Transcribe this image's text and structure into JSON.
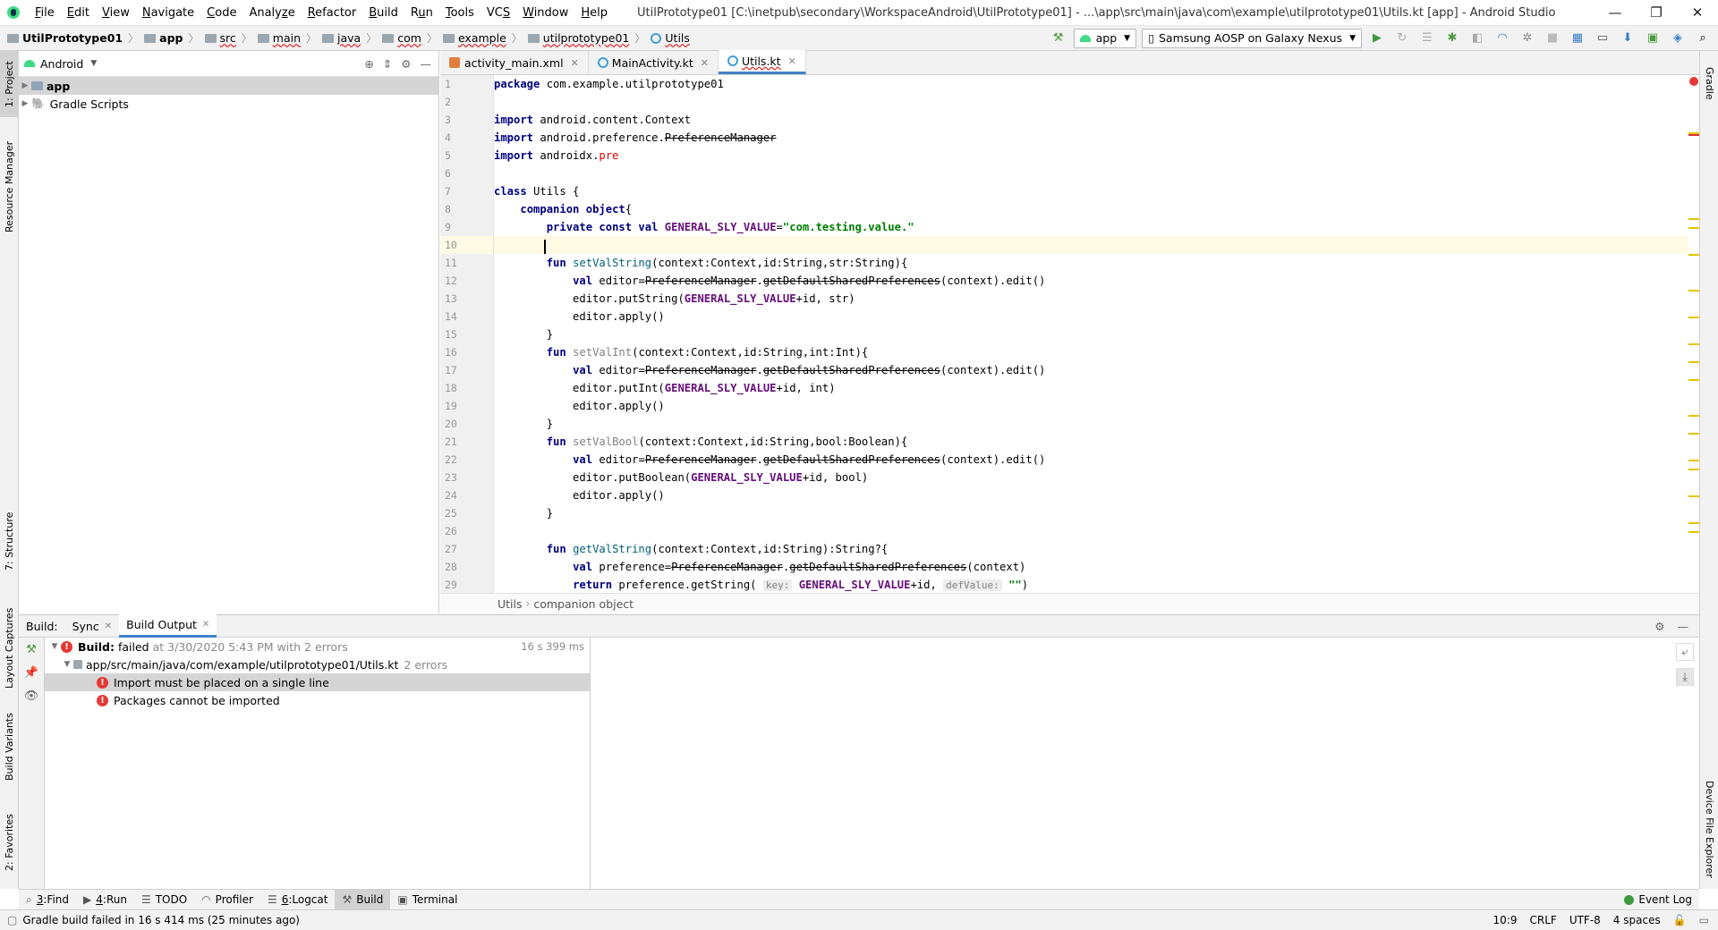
{
  "menu": {
    "items": [
      "File",
      "Edit",
      "View",
      "Navigate",
      "Code",
      "Analyze",
      "Refactor",
      "Build",
      "Run",
      "Tools",
      "VCS",
      "Window",
      "Help"
    ],
    "mnemonics": [
      "F",
      "E",
      "V",
      "N",
      "C",
      "z",
      "R",
      "B",
      "u",
      "T",
      "S",
      "W",
      "H"
    ],
    "window_title": "UtilPrototype01 [C:\\inetpub\\secondary\\WorkspaceAndroid\\UtilPrototype01] - ...\\app\\src\\main\\java\\com\\example\\utilprototype01\\Utils.kt [app] - Android Studio"
  },
  "window_controls": {
    "minimize": "—",
    "restore": "❐",
    "close": "✕"
  },
  "breadcrumb": [
    "UtilPrototype01",
    "app",
    "src",
    "main",
    "java",
    "com",
    "example",
    "utilprototype01",
    "Utils"
  ],
  "toolbar": {
    "run_config": "app",
    "device": "Samsung AOSP on Galaxy Nexus"
  },
  "left_strip": {
    "tabs": [
      "1: Project",
      "Resource Manager",
      "7: Structure",
      "Layout Captures",
      "Build Variants",
      "2: Favorites"
    ]
  },
  "right_strip": {
    "tabs": [
      "Gradle",
      "Device File Explorer"
    ]
  },
  "project_panel": {
    "view_mode": "Android",
    "tree": [
      {
        "label": "app",
        "selected": true
      },
      {
        "label": "Gradle Scripts",
        "selected": false
      }
    ]
  },
  "editor": {
    "tabs": [
      {
        "label": "activity_main.xml",
        "type": "xml",
        "active": false
      },
      {
        "label": "MainActivity.kt",
        "type": "kt",
        "active": false
      },
      {
        "label": "Utils.kt",
        "type": "kt",
        "active": true
      }
    ],
    "line_numbers": [
      "1",
      "2",
      "3",
      "4",
      "5",
      "6",
      "7",
      "8",
      "9",
      "10",
      "11",
      "12",
      "13",
      "14",
      "15",
      "16",
      "17",
      "18",
      "19",
      "20",
      "21",
      "22",
      "23",
      "24",
      "25",
      "26",
      "27",
      "28",
      "29"
    ],
    "current_line": 10,
    "code_lines": [
      [
        {
          "t": "package",
          "c": "kw"
        },
        {
          "t": " com.example.utilprototype01"
        }
      ],
      [],
      [
        {
          "t": "import",
          "c": "kw"
        },
        {
          "t": " android.content.Context"
        }
      ],
      [
        {
          "t": "import",
          "c": "kw"
        },
        {
          "t": " android.preference."
        },
        {
          "t": "PreferenceManager",
          "c": "dep"
        }
      ],
      [
        {
          "t": "import",
          "c": "kw"
        },
        {
          "t": " androidx."
        },
        {
          "t": "pre",
          "c": "unres"
        }
      ],
      [],
      [
        {
          "t": "class",
          "c": "kw"
        },
        {
          "t": " Utils {"
        }
      ],
      [
        {
          "t": "    "
        },
        {
          "t": "companion object",
          "c": "kw"
        },
        {
          "t": "{"
        }
      ],
      [
        {
          "t": "        "
        },
        {
          "t": "private const val",
          "c": "kw"
        },
        {
          "t": " "
        },
        {
          "t": "GENERAL_SLY_VALUE",
          "c": "cn"
        },
        {
          "t": "="
        },
        {
          "t": "\"com.testing.value.\"",
          "c": "str"
        }
      ],
      [
        {
          "t": "        "
        }
      ],
      [
        {
          "t": "        "
        },
        {
          "t": "fun",
          "c": "kw"
        },
        {
          "t": " "
        },
        {
          "t": "setValString",
          "c": "fnd"
        },
        {
          "t": "(context:Context,id:String,str:String){"
        }
      ],
      [
        {
          "t": "            "
        },
        {
          "t": "val",
          "c": "kw"
        },
        {
          "t": " editor="
        },
        {
          "t": "PreferenceManager",
          "c": "dep"
        },
        {
          "t": "."
        },
        {
          "t": "getDefaultSharedPreferences",
          "c": "dep"
        },
        {
          "t": "(context).edit()"
        }
      ],
      [
        {
          "t": "            editor.putString("
        },
        {
          "t": "GENERAL_SLY_VALUE",
          "c": "cn"
        },
        {
          "t": "+id, str)"
        }
      ],
      [
        {
          "t": "            editor.apply()"
        }
      ],
      [
        {
          "t": "        }"
        }
      ],
      [
        {
          "t": "        "
        },
        {
          "t": "fun",
          "c": "kw"
        },
        {
          "t": " "
        },
        {
          "t": "setValInt",
          "c": "gray"
        },
        {
          "t": "(context:Context,id:String,int:Int){"
        }
      ],
      [
        {
          "t": "            "
        },
        {
          "t": "val",
          "c": "kw"
        },
        {
          "t": " editor="
        },
        {
          "t": "PreferenceManager",
          "c": "dep"
        },
        {
          "t": "."
        },
        {
          "t": "getDefaultSharedPreferences",
          "c": "dep"
        },
        {
          "t": "(context).edit()"
        }
      ],
      [
        {
          "t": "            editor.putInt("
        },
        {
          "t": "GENERAL_SLY_VALUE",
          "c": "cn"
        },
        {
          "t": "+id, int)"
        }
      ],
      [
        {
          "t": "            editor.apply()"
        }
      ],
      [
        {
          "t": "        }"
        }
      ],
      [
        {
          "t": "        "
        },
        {
          "t": "fun",
          "c": "kw"
        },
        {
          "t": " "
        },
        {
          "t": "setValBool",
          "c": "gray"
        },
        {
          "t": "(context:Context,id:String,bool:Boolean){"
        }
      ],
      [
        {
          "t": "            "
        },
        {
          "t": "val",
          "c": "kw"
        },
        {
          "t": " editor="
        },
        {
          "t": "PreferenceManager",
          "c": "dep"
        },
        {
          "t": "."
        },
        {
          "t": "getDefaultSharedPreferences",
          "c": "dep"
        },
        {
          "t": "(context).edit()"
        }
      ],
      [
        {
          "t": "            editor.putBoolean("
        },
        {
          "t": "GENERAL_SLY_VALUE",
          "c": "cn"
        },
        {
          "t": "+id, bool)"
        }
      ],
      [
        {
          "t": "            editor.apply()"
        }
      ],
      [
        {
          "t": "        }"
        }
      ],
      [],
      [
        {
          "t": "        "
        },
        {
          "t": "fun",
          "c": "kw"
        },
        {
          "t": " "
        },
        {
          "t": "getValString",
          "c": "fnd"
        },
        {
          "t": "(context:Context,id:String):String?{"
        }
      ],
      [
        {
          "t": "            "
        },
        {
          "t": "val",
          "c": "kw"
        },
        {
          "t": " preference="
        },
        {
          "t": "PreferenceManager",
          "c": "dep"
        },
        {
          "t": "."
        },
        {
          "t": "getDefaultSharedPreferences",
          "c": "dep"
        },
        {
          "t": "(context)"
        }
      ],
      [
        {
          "t": "            "
        },
        {
          "t": "return",
          "c": "kw"
        },
        {
          "t": " preference.getString( "
        },
        {
          "t": "key:",
          "c": "hint"
        },
        {
          "t": " "
        },
        {
          "t": "GENERAL_SLY_VALUE",
          "c": "cn"
        },
        {
          "t": "+id, "
        },
        {
          "t": "defValue:",
          "c": "hint"
        },
        {
          "t": " "
        },
        {
          "t": "\"\"",
          "c": "str"
        },
        {
          "t": ")"
        }
      ]
    ],
    "breadcrumb": [
      "Utils",
      "companion object"
    ]
  },
  "build": {
    "label": "Build:",
    "tabs": [
      {
        "label": "Sync",
        "active": false
      },
      {
        "label": "Build Output",
        "active": true
      }
    ],
    "summary_label": "Build:",
    "summary_status": "failed",
    "summary_detail": "at 3/30/2020 5:43 PM with 2 errors",
    "duration": "16 s 399 ms",
    "file_path": "app/src/main/java/com/example/utilprototype01/Utils.kt",
    "file_errors": "2 errors",
    "errors": [
      {
        "message": "Import must be placed on a single line",
        "selected": true
      },
      {
        "message": "Packages cannot be imported",
        "selected": false
      }
    ]
  },
  "tool_windows": [
    {
      "label": "Find",
      "mn": "3",
      "icon": "search-icon"
    },
    {
      "label": "Run",
      "mn": "4",
      "icon": "run-icon"
    },
    {
      "label": "TODO",
      "mn": "",
      "icon": "todo-icon"
    },
    {
      "label": "Profiler",
      "mn": "",
      "icon": "profiler-icon"
    },
    {
      "label": "Logcat",
      "mn": "6",
      "icon": "logcat-icon"
    },
    {
      "label": "Build",
      "mn": "",
      "icon": "hammer-icon",
      "selected": true
    },
    {
      "label": "Terminal",
      "mn": "",
      "icon": "terminal-icon"
    }
  ],
  "event_log": "Event Log",
  "status": {
    "message": "Gradle build failed in 16 s 414 ms (25 minutes ago)",
    "position": "10:9",
    "line_separator": "CRLF",
    "encoding": "UTF-8",
    "indent": "4 spaces"
  },
  "colors": {
    "accent": "#4083c9",
    "error": "#e53935",
    "android_green": "#3ddc84"
  }
}
